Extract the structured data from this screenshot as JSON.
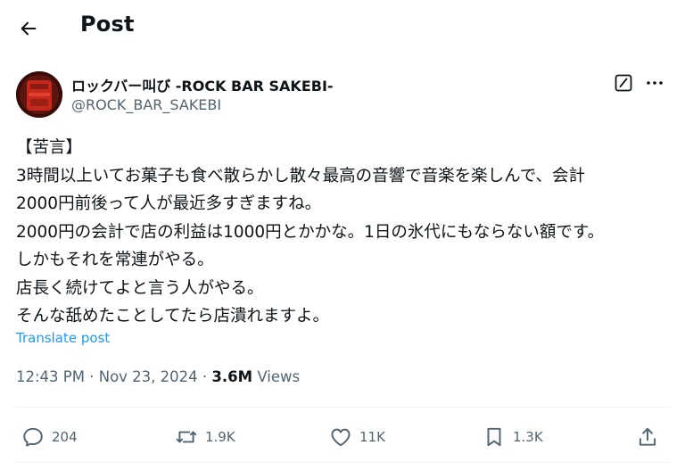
{
  "header": {
    "title": "Post"
  },
  "author": {
    "display_name": "ロックバー叫び -ROCK BAR SAKEBI-",
    "handle": "@ROCK_BAR_SAKEBI"
  },
  "post": {
    "lines": [
      "【苦言】",
      "3時間以上いてお菓子も食べ散らかし散々最高の音響で音楽を楽しんで、会計",
      "2000円前後って人が最近多すぎますね。",
      "2000円の会計で店の利益は1000円とかかな。1日の氷代にもならない額です。",
      "しかもそれを常連がやる。",
      "店長く続けてよと言う人がやる。",
      "そんな舐めたことしてたら店潰れますよ。"
    ],
    "translate_label": "Translate post",
    "time": "12:43 PM",
    "separator": " · ",
    "date": "Nov 23, 2024",
    "views_count": "3.6M",
    "views_label": " Views"
  },
  "actions": {
    "replies": "204",
    "reposts": "1.9K",
    "likes": "11K",
    "bookmarks": "1.3K"
  },
  "icons": [
    "back-arrow-icon",
    "edit-icon",
    "more-icon",
    "reply-icon",
    "repost-icon",
    "like-icon",
    "bookmark-icon",
    "share-icon"
  ],
  "colors": {
    "text": "#0f1419",
    "secondary": "#536471",
    "link": "#1d9bf0",
    "divider": "#eff3f4"
  }
}
